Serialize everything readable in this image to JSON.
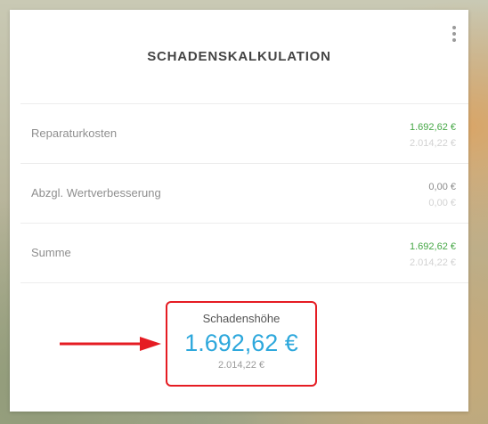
{
  "card": {
    "title": "SCHADENSKALKULATION",
    "menu_icon": "more-vertical-icon"
  },
  "rows": [
    {
      "label": "Reparaturkosten",
      "value": "1.692,62 €",
      "value_secondary": "2.014,22 €",
      "value_color": "green"
    },
    {
      "label": "Abzgl. Wertverbesserung",
      "value": "0,00 €",
      "value_secondary": "0,00 €",
      "value_color": "grey"
    },
    {
      "label": "Summe",
      "value": "1.692,62 €",
      "value_secondary": "2.014,22 €",
      "value_color": "green"
    }
  ],
  "damage": {
    "label": "Schadenshöhe",
    "value": "1.692,62 €",
    "secondary": "2.014,22 €"
  },
  "annotation": {
    "arrow_icon": "red-arrow-icon",
    "highlight_color": "#e51c23"
  },
  "colors": {
    "green": "#45a745",
    "accent_blue": "#2ea8dc",
    "title": "#444444"
  }
}
